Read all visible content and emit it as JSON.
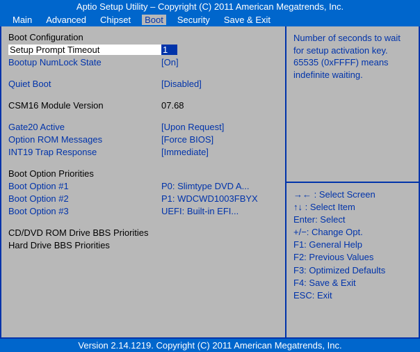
{
  "header": "Aptio Setup Utility – Copyright (C) 2011 American Megatrends, Inc.",
  "footer": "Version 2.14.1219. Copyright (C) 2011 American Megatrends, Inc.",
  "menu": {
    "items": [
      "Main",
      "Advanced",
      "Chipset",
      "Boot",
      "Security",
      "Save & Exit"
    ],
    "active": "Boot"
  },
  "sections": {
    "boot_config_header": "Boot Configuration",
    "setup_prompt": {
      "label": "Setup Prompt Timeout",
      "value": "1"
    },
    "numlock": {
      "label": "Bootup NumLock State",
      "value": "[On]"
    },
    "quiet_boot": {
      "label": "Quiet Boot",
      "value": "[Disabled]"
    },
    "csm": {
      "label": "CSM16 Module Version",
      "value": "07.68"
    },
    "gate20": {
      "label": "Gate20 Active",
      "value": "[Upon Request]"
    },
    "oprom": {
      "label": "Option ROM Messages",
      "value": "[Force BIOS]"
    },
    "int19": {
      "label": "INT19 Trap Response",
      "value": "[Immediate]"
    },
    "boot_prio_header": "Boot Option Priorities",
    "boot1": {
      "label": "Boot Option #1",
      "value": "P0: Slimtype DVD A..."
    },
    "boot2": {
      "label": "Boot Option #2",
      "value": "P1: WDCWD1003FBYX"
    },
    "boot3": {
      "label": "Boot Option #3",
      "value": "UEFI: Built-in EFI..."
    },
    "cddvd": "CD/DVD ROM Drive BBS Priorities",
    "hdd": "Hard Drive BBS Priorities"
  },
  "help": {
    "desc": "Number of seconds to wait for setup activation key. 65535 (0xFFFF) means indefinite waiting.",
    "k1": "→← : Select Screen",
    "k2": "↑↓ : Select Item",
    "k3": "Enter: Select",
    "k4": "+/−: Change Opt.",
    "k5": "F1: General Help",
    "k6": "F2: Previous Values",
    "k7": "F3: Optimized Defaults",
    "k8": "F4: Save & Exit",
    "k9": "ESC: Exit"
  }
}
